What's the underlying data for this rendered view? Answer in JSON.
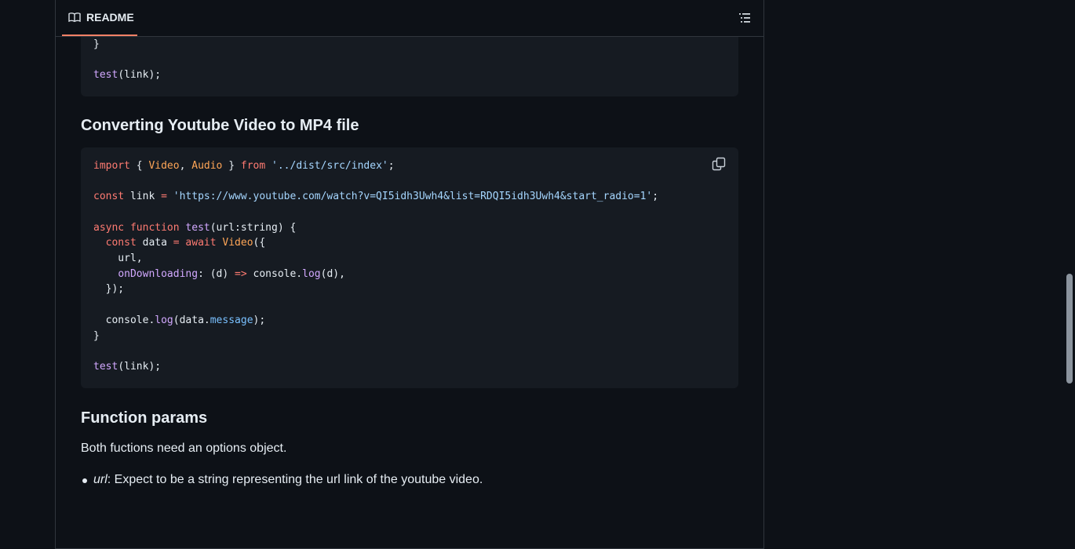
{
  "header": {
    "tab_label": "README"
  },
  "code1": {
    "lines": [
      "}",
      "",
      "test(link);"
    ]
  },
  "section1": {
    "title": "Converting Youtube Video to MP4 file"
  },
  "code2": {
    "import_kw": "import",
    "import_open": " { ",
    "import_video": "Video",
    "import_comma": ", ",
    "import_audio": "Audio",
    "import_close": " } ",
    "from_kw": "from",
    "import_path": " '../dist/src/index'",
    "semicolon": ";",
    "const_kw": "const",
    "link_var": " link ",
    "equals": "=",
    "link_url": " 'https://www.youtube.com/watch?v=QI5idh3Uwh4&list=RDQI5idh3Uwh4&start_radio=1'",
    "async_kw": "async",
    "function_kw": " function",
    "fn_name": " test",
    "fn_params": "(url:string) {",
    "const_data": "  const",
    "data_var": " data ",
    "await_kw": " await",
    "video_call": " Video",
    "open_obj": "({",
    "url_line": "    url,",
    "ondl_indent": "    ",
    "ondl_key": "onDownloading",
    "ondl_colon": ": (d) ",
    "arrow": "=>",
    "ondl_console": " console.",
    "log_fn": "log",
    "ondl_end": "(d),",
    "close_obj": "  });",
    "console_indent": "  console.",
    "log_fn2": "log",
    "data_open": "(data.",
    "message_prop": "message",
    "data_close": ");",
    "close_fn": "}",
    "test_fn": "test",
    "test_args": "(link);"
  },
  "section2": {
    "title": "Function params",
    "intro": "Both fuctions need an options object.",
    "bullets": [
      {
        "name": "url",
        "desc": ": Expect to be a string representing the url link of the youtube video."
      }
    ]
  },
  "colors": {
    "background": "#0d1117",
    "code_bg": "#161b22",
    "accent_tab": "#f78166"
  },
  "icons": [
    "book-icon",
    "list-outline-icon",
    "copy-icon"
  ]
}
